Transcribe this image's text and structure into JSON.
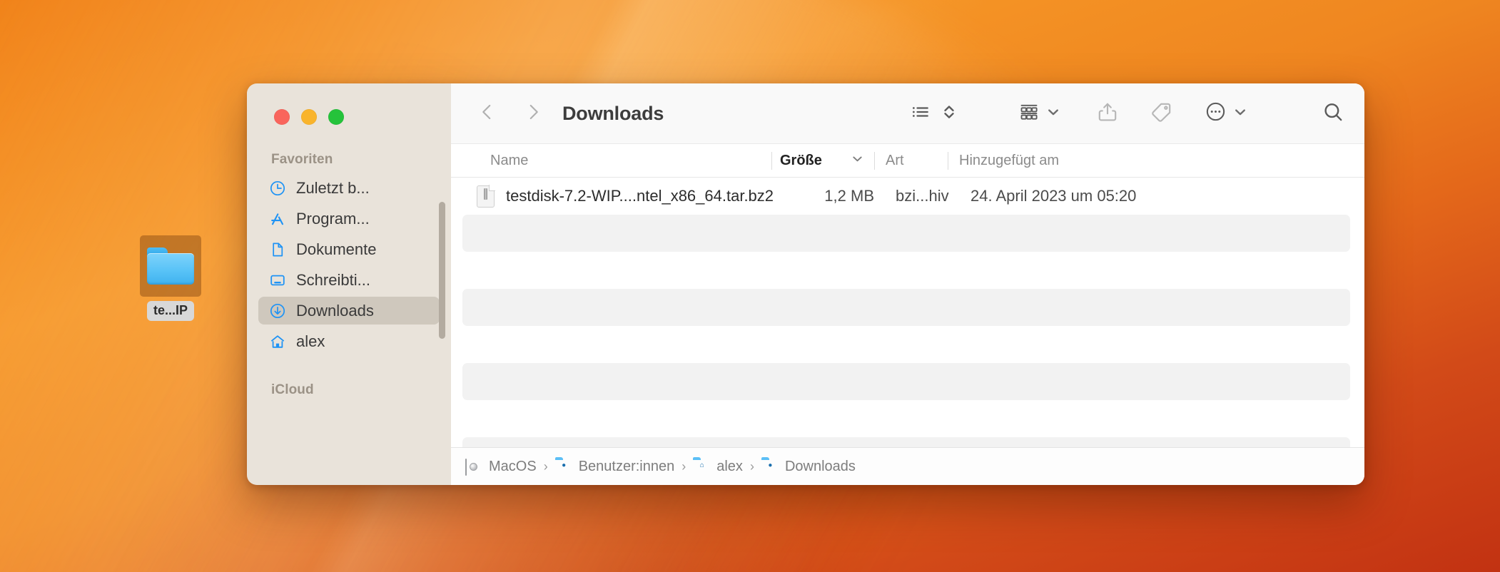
{
  "desktop": {
    "icon": {
      "name": "folder-icon",
      "label": "te...IP",
      "selected": true
    }
  },
  "window": {
    "traffic_lights": [
      {
        "name": "close-button",
        "color": "#f9655c"
      },
      {
        "name": "minimize-button",
        "color": "#f9b42c"
      },
      {
        "name": "zoom-button",
        "color": "#25c33b"
      }
    ],
    "title": "Downloads"
  },
  "sidebar": {
    "sections": [
      {
        "title": "Favoriten",
        "items": [
          {
            "label": "Zuletzt b...",
            "icon": "clock-icon",
            "selected": false
          },
          {
            "label": "Program...",
            "icon": "appstore-icon",
            "selected": false
          },
          {
            "label": "Dokumente",
            "icon": "document-icon",
            "selected": false
          },
          {
            "label": "Schreibti...",
            "icon": "desktop-icon",
            "selected": false
          },
          {
            "label": "Downloads",
            "icon": "download-icon",
            "selected": true
          },
          {
            "label": "alex",
            "icon": "home-icon",
            "selected": false
          }
        ]
      },
      {
        "title": "iCloud",
        "items": []
      }
    ]
  },
  "toolbar": {
    "back": "back-icon",
    "forward": "forward-icon",
    "view_list": "list-view-icon",
    "sort": "sort-arrows-icon",
    "group": "group-view-icon",
    "group_chevron": "chevron-down-icon",
    "share": "share-icon",
    "tag": "tag-icon",
    "more": "more-actions-icon",
    "more_chevron": "chevron-down-icon",
    "search": "search-icon"
  },
  "file_list": {
    "columns": [
      {
        "key": "name",
        "label": "Name",
        "sorted": false
      },
      {
        "key": "size",
        "label": "Größe",
        "sorted": true
      },
      {
        "key": "kind",
        "label": "Art",
        "sorted": false
      },
      {
        "key": "added",
        "label": "Hinzugefügt am",
        "sorted": false
      }
    ],
    "rows": [
      {
        "name": "testdisk-7.2-WIP....ntel_x86_64.tar.bz2",
        "size": "1,2 MB",
        "kind": "bzi...hiv",
        "added": "24. April 2023 um 05:20",
        "icon": "archive-file-icon",
        "striped": false
      }
    ],
    "empty_rows": [
      {
        "striped": true
      },
      {
        "striped": false
      },
      {
        "striped": true
      },
      {
        "striped": false
      },
      {
        "striped": true
      },
      {
        "striped": false
      },
      {
        "striped": true
      }
    ]
  },
  "path_bar": {
    "crumbs": [
      {
        "label": "MacOS",
        "icon": "hard-drive-icon"
      },
      {
        "label": "Benutzer:innen",
        "icon": "users-folder-icon"
      },
      {
        "label": "alex",
        "icon": "home-folder-icon"
      },
      {
        "label": "Downloads",
        "icon": "downloads-folder-icon"
      }
    ],
    "separator": "›"
  },
  "colors": {
    "accent_blue": "#1e93f5",
    "sidebar_bg": "#e9e3da",
    "selection_bg": "#cfc8bd",
    "stripe": "#f2f2f2",
    "wallpaper_orange": "#ef8620"
  }
}
